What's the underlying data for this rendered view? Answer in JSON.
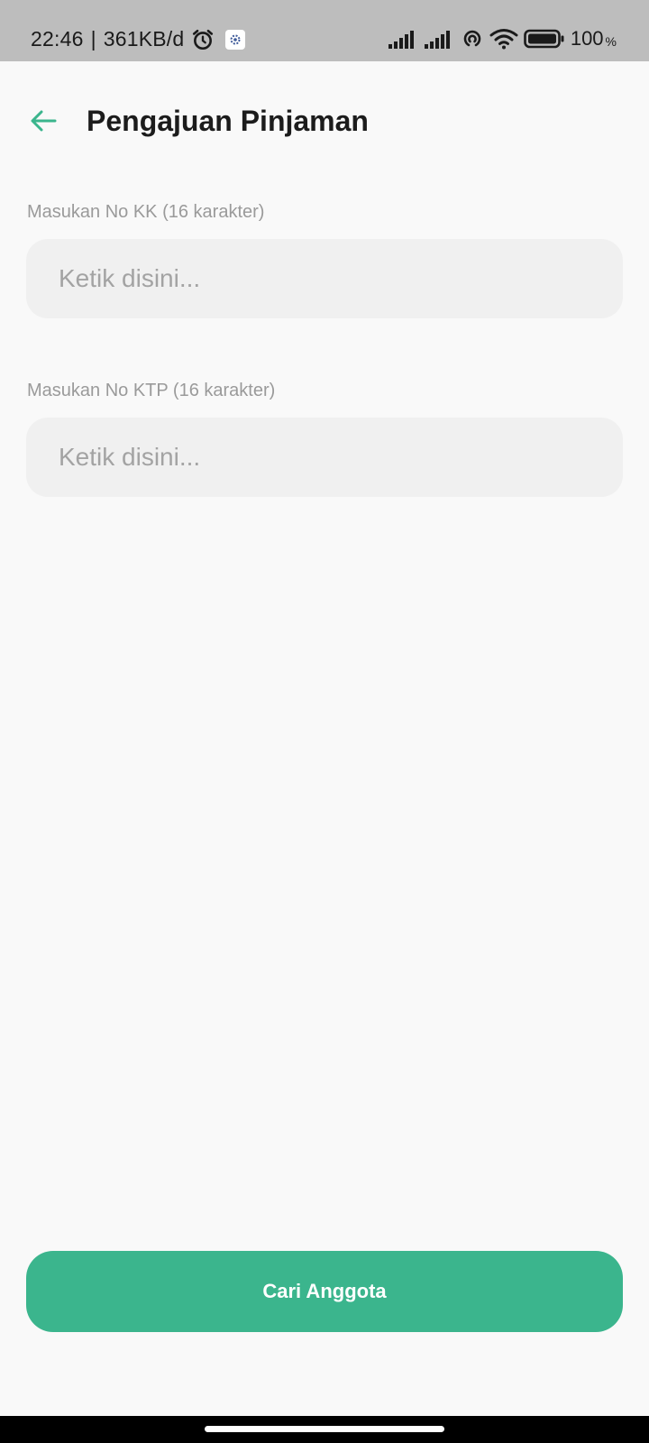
{
  "status_bar": {
    "time": "22:46",
    "separator": "|",
    "data_rate": "361KB/d",
    "battery_level": "100",
    "battery_unit": "%",
    "icons": [
      "alarm-icon",
      "app-notification-icon",
      "signal-icon",
      "signal-icon",
      "hotspot-icon",
      "wifi-icon",
      "battery-icon"
    ]
  },
  "header": {
    "title": "Pengajuan Pinjaman",
    "back_icon": "arrow-left-icon"
  },
  "form": {
    "kk": {
      "label": "Masukan No KK (16 karakter)",
      "placeholder": "Ketik disini...",
      "value": ""
    },
    "ktp": {
      "label": "Masukan No KTP (16 karakter)",
      "placeholder": "Ketik disini...",
      "value": ""
    }
  },
  "actions": {
    "search_button_label": "Cari Anggota"
  },
  "colors": {
    "accent": "#3bb58d",
    "status_bar": "#bdbdbd",
    "background": "#f9f9f9",
    "input_background": "#f0f0f0"
  }
}
